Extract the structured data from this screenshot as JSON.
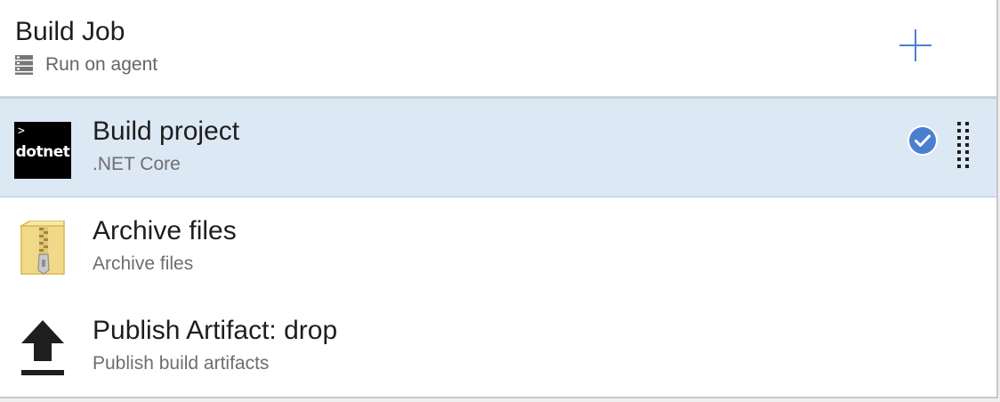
{
  "job": {
    "title": "Build Job",
    "subtitle": "Run on agent",
    "agent_icon": "server-icon",
    "add_icon": "plus-icon"
  },
  "tasks": [
    {
      "name": "Build project",
      "subtitle": ".NET Core",
      "icon": "dotnet-icon",
      "icon_text": "dotnet",
      "icon_prompt": ">",
      "selected": true,
      "enabled": true
    },
    {
      "name": "Archive files",
      "subtitle": "Archive files",
      "icon": "zip-archive-icon",
      "selected": false
    },
    {
      "name": "Publish Artifact: drop",
      "subtitle": "Publish build artifacts",
      "icon": "upload-arrow-icon",
      "selected": false
    }
  ],
  "colors": {
    "accent": "#4a7fd0",
    "selected_bg": "#dde8f5",
    "divider": "#d4d4d4"
  }
}
